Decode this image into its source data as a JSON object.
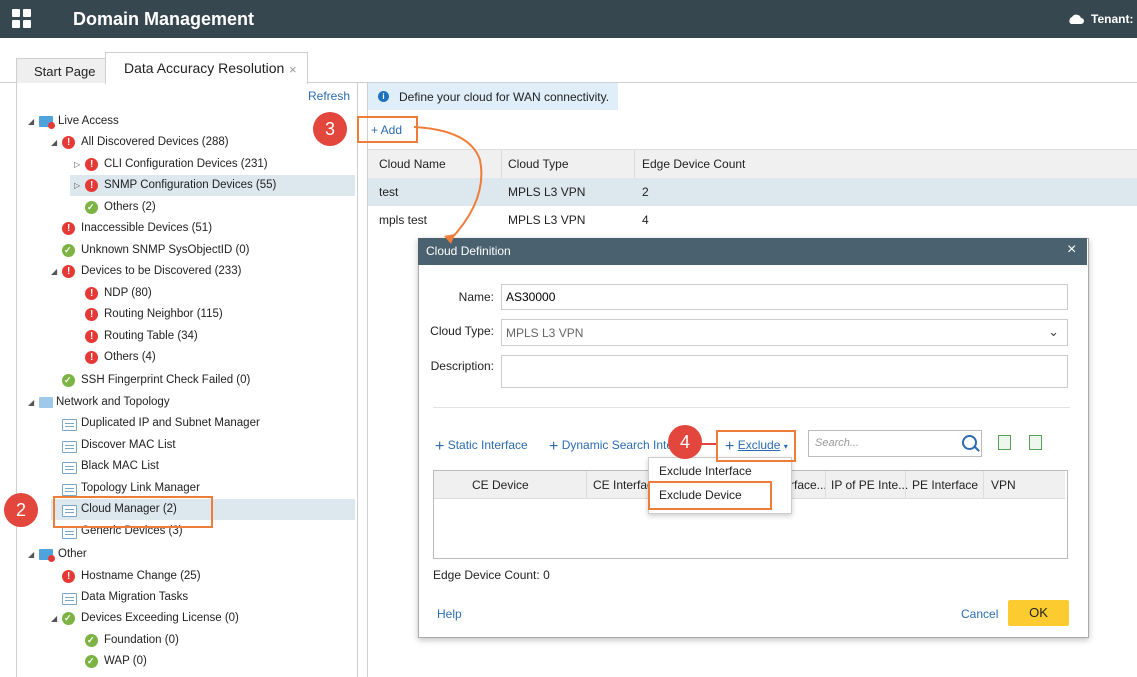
{
  "app": {
    "title": "Domain Management",
    "tenant": "Tenant:"
  },
  "tabs": {
    "start": "Start Page",
    "active": "Data Accuracy Resolution",
    "close": "×"
  },
  "tree": {
    "refresh": "Refresh",
    "items": [
      {
        "label": "Live Access",
        "icon": "folder-alert-icon"
      },
      {
        "label": "All Discovered Devices (288)",
        "icon": "error-icon"
      },
      {
        "label": "CLI Configuration Devices (231)",
        "icon": "error-icon"
      },
      {
        "label": "SNMP Configuration Devices (55)",
        "icon": "error-icon"
      },
      {
        "label": "Others (2)",
        "icon": "ok-icon"
      },
      {
        "label": "Inaccessible Devices (51)",
        "icon": "error-icon"
      },
      {
        "label": "Unknown SNMP SysObjectID (0)",
        "icon": "ok-icon"
      },
      {
        "label": "Devices to be Discovered (233)",
        "icon": "error-icon"
      },
      {
        "label": "NDP (80)",
        "icon": "error-icon"
      },
      {
        "label": "Routing Neighbor (115)",
        "icon": "error-icon"
      },
      {
        "label": "Routing Table (34)",
        "icon": "error-icon"
      },
      {
        "label": "Others (4)",
        "icon": "error-icon"
      },
      {
        "label": "SSH Fingerprint Check Failed (0)",
        "icon": "ok-icon"
      },
      {
        "label": "Network and Topology",
        "icon": "folder-icon"
      },
      {
        "label": "Duplicated IP and Subnet Manager",
        "icon": "page-icon"
      },
      {
        "label": "Discover MAC List",
        "icon": "page-icon"
      },
      {
        "label": "Black MAC List",
        "icon": "page-icon"
      },
      {
        "label": "Topology Link Manager",
        "icon": "page-icon"
      },
      {
        "label": "Cloud Manager (2)",
        "icon": "page-icon"
      },
      {
        "label": "Generic Devices (3)",
        "icon": "page-icon"
      },
      {
        "label": "Other",
        "icon": "folder-alert-icon"
      },
      {
        "label": "Hostname Change (25)",
        "icon": "error-icon"
      },
      {
        "label": "Data Migration Tasks",
        "icon": "page-icon"
      },
      {
        "label": "Devices Exceeding License (0)",
        "icon": "ok-icon"
      },
      {
        "label": "Foundation (0)",
        "icon": "ok-icon"
      },
      {
        "label": "WAP (0)",
        "icon": "ok-icon"
      }
    ]
  },
  "callouts": [
    "3",
    "2",
    "4"
  ],
  "main": {
    "info": "Define your cloud for WAN connectivity.",
    "add": "+ Add",
    "columns": [
      "Cloud Name",
      "Cloud Type",
      "Edge Device Count"
    ],
    "rows": [
      {
        "name": "test",
        "type": "MPLS L3 VPN",
        "count": "2"
      },
      {
        "name": "mpls test",
        "type": "MPLS L3 VPN",
        "count": "4"
      }
    ]
  },
  "dialog": {
    "title": "Cloud Definition",
    "close": "×",
    "name_label": "Name:",
    "name_value": "AS30000",
    "type_label": "Cloud Type:",
    "type_value": "MPLS L3 VPN",
    "desc_label": "Description:",
    "static_interface": "Static Interface",
    "dynamic_search": "Dynamic Search Inte",
    "exclude": "Exclude",
    "search_placeholder": "Search...",
    "ce_columns": [
      "CE Device",
      "CE Interfac",
      "rface...",
      "IP of PE Inte...",
      "PE Interface",
      "VPN"
    ],
    "dropdown": [
      "Exclude Interface",
      "Exclude Device"
    ],
    "edge_count": "Edge Device Count: 0",
    "help": "Help",
    "cancel": "Cancel",
    "ok": "OK"
  },
  "colors": {
    "topbar": "#37474f",
    "callout": "#e2463c",
    "highlight": "#ee7d3a",
    "ok_button": "#fccb2f",
    "link": "#2b6cb0"
  }
}
